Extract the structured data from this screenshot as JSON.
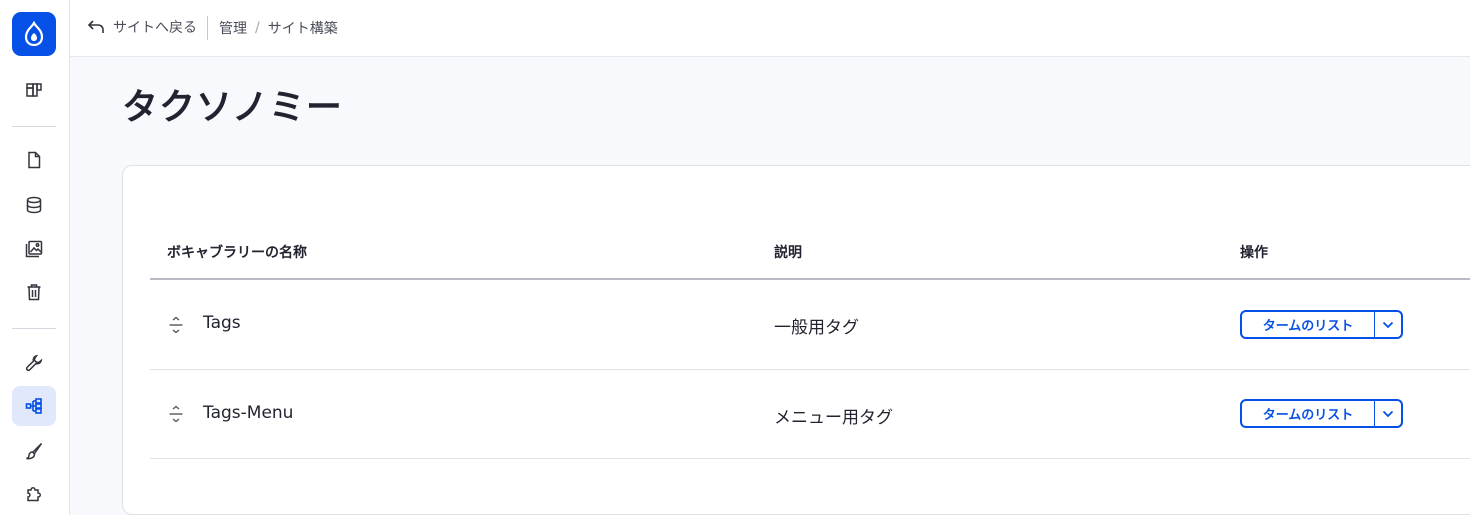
{
  "topbar": {
    "back_label": "サイトへ戻る",
    "breadcrumb": [
      "管理",
      "サイト構築"
    ]
  },
  "page": {
    "title": "タクソノミー"
  },
  "table": {
    "headers": {
      "name": "ボキャブラリーの名称",
      "description": "説明",
      "operations": "操作"
    },
    "rows": [
      {
        "name": "Tags",
        "description": "一般用タグ",
        "action": "タームのリスト"
      },
      {
        "name": "Tags-Menu",
        "description": "メニュー用タグ",
        "action": "タームのリスト"
      }
    ]
  },
  "sidebar": {
    "icons": [
      "drupal-logo-icon",
      "dashboard-icon",
      "content-icon",
      "database-icon",
      "media-icon",
      "trash-icon",
      "wrench-icon",
      "structure-icon",
      "brush-icon",
      "puzzle-icon"
    ],
    "active": "structure-icon"
  },
  "colors": {
    "accent": "#0550e6",
    "active_bg": "#e1e8fb",
    "page_bg": "#f8f9fc"
  }
}
